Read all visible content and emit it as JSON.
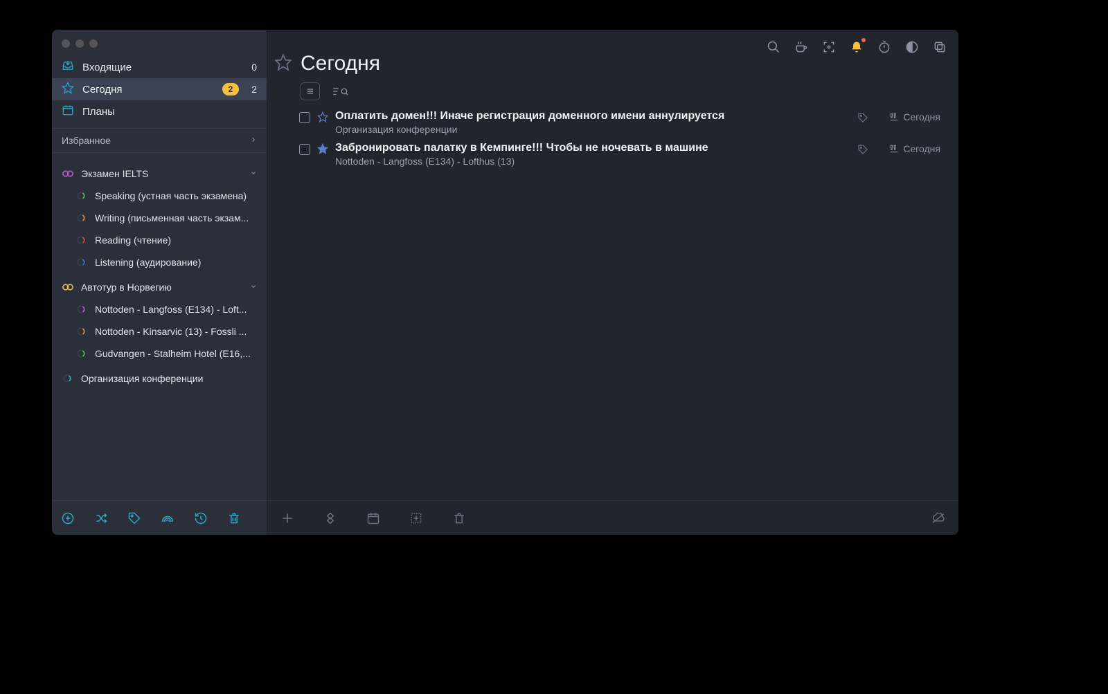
{
  "sidebar": {
    "inbox": {
      "label": "Входящие",
      "count": "0"
    },
    "today": {
      "label": "Сегодня",
      "badge": "2",
      "count": "2"
    },
    "plans": {
      "label": "Планы"
    },
    "section": "Избранное"
  },
  "projects": [
    {
      "name": "Экзамен IELTS",
      "color": "#b45ed0",
      "children": [
        {
          "name": "Speaking (устная часть экзамена)",
          "color": "#4fbd5a"
        },
        {
          "name": "Writing (письменная часть экзам...",
          "color": "#e78a3a"
        },
        {
          "name": "Reading (чтение)",
          "color": "#e0483f"
        },
        {
          "name": "Listening (аудирование)",
          "color": "#4a6fe0"
        }
      ]
    },
    {
      "name": "Автотур в Норвегию",
      "color": "#d6c04c",
      "children": [
        {
          "name": "Nottoden - Langfoss (E134) - Loft...",
          "color": "#b45ed0"
        },
        {
          "name": "Nottoden - Kinsarvic (13) - Fossli ...",
          "color": "#e78a3a"
        },
        {
          "name": "Gudvangen - Stalheim Hotel (E16,...",
          "color": "#4fbd5a"
        }
      ]
    },
    {
      "name": "Организация конференции",
      "color": "#2aa7c4",
      "children": []
    }
  ],
  "header": {
    "title": "Сегодня"
  },
  "tasks": [
    {
      "title": "Оплатить домен!!! Иначе регистрация доменного имени аннулируется",
      "subtitle": "Организация конференции",
      "due": "Сегодня",
      "star_fill": false
    },
    {
      "title": "Забронировать палатку в Кемпинге!!! Чтобы не ночевать в машине",
      "subtitle": "Nottoden - Langfoss (E134) - Lofthus (13)",
      "due": "Сегодня",
      "star_fill": true
    }
  ]
}
